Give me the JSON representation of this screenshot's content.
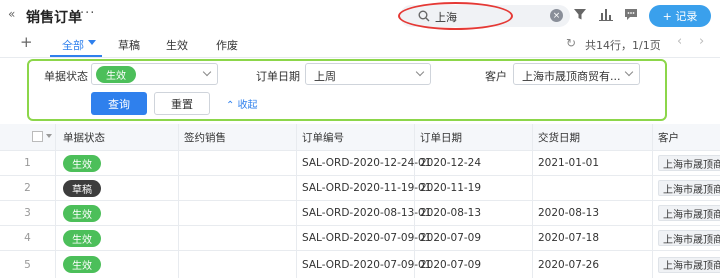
{
  "header": {
    "title": "销售订单",
    "back_icon": "«",
    "more_icon": "···",
    "search_value": "上海",
    "add_button": "+ 记录"
  },
  "tabs": {
    "items": [
      "全部",
      "草稿",
      "生效",
      "作废"
    ],
    "active": "全部"
  },
  "pager": {
    "text": "共14行，1/1页",
    "prev": "‹",
    "next": "›"
  },
  "filters": {
    "status_label": "单据状态",
    "status_value": "生效",
    "date_label": "订单日期",
    "date_value": "上周",
    "customer_label": "客户",
    "customer_value": "上海市晟顶商贸有...",
    "query_button": "查询",
    "reset_button": "重置",
    "collapse_link": "收起"
  },
  "table": {
    "columns": [
      "单据状态",
      "签约销售",
      "订单编号",
      "订单日期",
      "交货日期",
      "客户"
    ],
    "rows": [
      {
        "index": "1",
        "status": "生效",
        "sales": "",
        "order_no": "SAL-ORD-2020-12-24-01",
        "order_date": "2020-12-24",
        "delivery_date": "2021-01-01",
        "customer": "上海市晟顶商"
      },
      {
        "index": "2",
        "status": "草稿",
        "sales": "",
        "order_no": "SAL-ORD-2020-11-19-01",
        "order_date": "2020-11-19",
        "delivery_date": "",
        "customer": "上海市晟顶商"
      },
      {
        "index": "3",
        "status": "生效",
        "sales": "",
        "order_no": "SAL-ORD-2020-08-13-01",
        "order_date": "2020-08-13",
        "delivery_date": "2020-08-13",
        "customer": "上海市晟顶商"
      },
      {
        "index": "4",
        "status": "生效",
        "sales": "",
        "order_no": "SAL-ORD-2020-07-09-01",
        "order_date": "2020-07-09",
        "delivery_date": "2020-07-18",
        "customer": "上海市晟顶商"
      },
      {
        "index": "5",
        "status": "生效",
        "sales": "",
        "order_no": "SAL-ORD-2020-07-09-01",
        "order_date": "2020-07-09",
        "delivery_date": "2020-07-26",
        "customer": "上海市晟顶商"
      }
    ]
  },
  "colors": {
    "accent": "#2f80ed",
    "status_effective": "#4cbf5a",
    "status_draft": "#3d3d3d",
    "search_highlight": "#e53935",
    "panel_highlight": "#8cd64a"
  },
  "icons": [
    "back-icon",
    "more-icon",
    "search-icon",
    "clear-icon",
    "filter-icon",
    "chart-icon",
    "message-icon",
    "add-icon",
    "refresh-icon",
    "prev-page-icon",
    "next-page-icon",
    "chevron-down-icon"
  ]
}
